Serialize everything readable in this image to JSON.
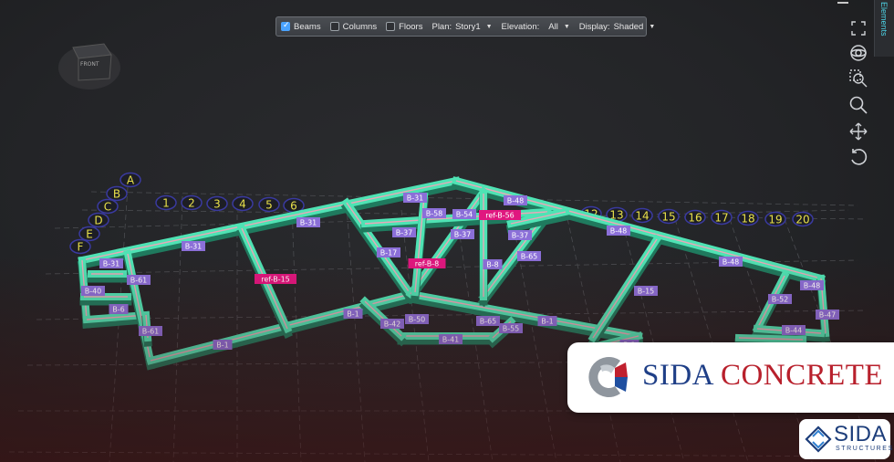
{
  "toolbar": {
    "beams": {
      "label": "Beams",
      "checked": true
    },
    "columns": {
      "label": "Columns",
      "checked": false
    },
    "floors": {
      "label": "Floors",
      "checked": false
    },
    "plan": {
      "label": "Plan:",
      "value": "Story1"
    },
    "elevation": {
      "label": "Elevation:",
      "value": "All"
    },
    "display": {
      "label": "Display:",
      "value": "Shaded"
    }
  },
  "side_panel": {
    "tab_label": "Elements"
  },
  "view_cube": {
    "face_label": "FRONT"
  },
  "side_icons": [
    "fit-view-icon",
    "orbit-icon",
    "zoom-window-icon",
    "zoom-icon",
    "pan-icon",
    "undo-view-icon"
  ],
  "grid": {
    "letters": [
      "A",
      "B",
      "C",
      "D",
      "E",
      "F"
    ],
    "numbers_left": [
      "1",
      "2",
      "3",
      "4",
      "5",
      "6"
    ],
    "numbers_right": [
      "12",
      "13",
      "14",
      "15",
      "16",
      "17",
      "18",
      "19",
      "20"
    ]
  },
  "beam_labels": [
    "B-31",
    "B-31",
    "B-31",
    "B-31",
    "B-48",
    "B-48",
    "B-48",
    "B-48",
    "B-58",
    "B-54",
    "B-37",
    "B-37",
    "B-37",
    "B-17",
    "B-8",
    "B-65",
    "B-61",
    "B-61",
    "B-40",
    "B-6",
    "B-1",
    "B-1",
    "B-1",
    "B-1",
    "B-42",
    "B-50",
    "B-41",
    "B-65",
    "B-55",
    "B-15",
    "B-52",
    "B-47",
    "B-44"
  ],
  "ref_labels": [
    "ref-B-56",
    "ref-B-8",
    "ref-B-15"
  ],
  "brand": {
    "word1": "SIDA",
    "word2": "CONCRETE"
  },
  "badge": {
    "name": "SIDA",
    "sub": "STRUCTURES"
  },
  "colors": {
    "beam": "#4fe3b4",
    "tag": "#8b6fd8",
    "ref_tag": "#e0177f",
    "grid_label": "#e8e04a"
  }
}
